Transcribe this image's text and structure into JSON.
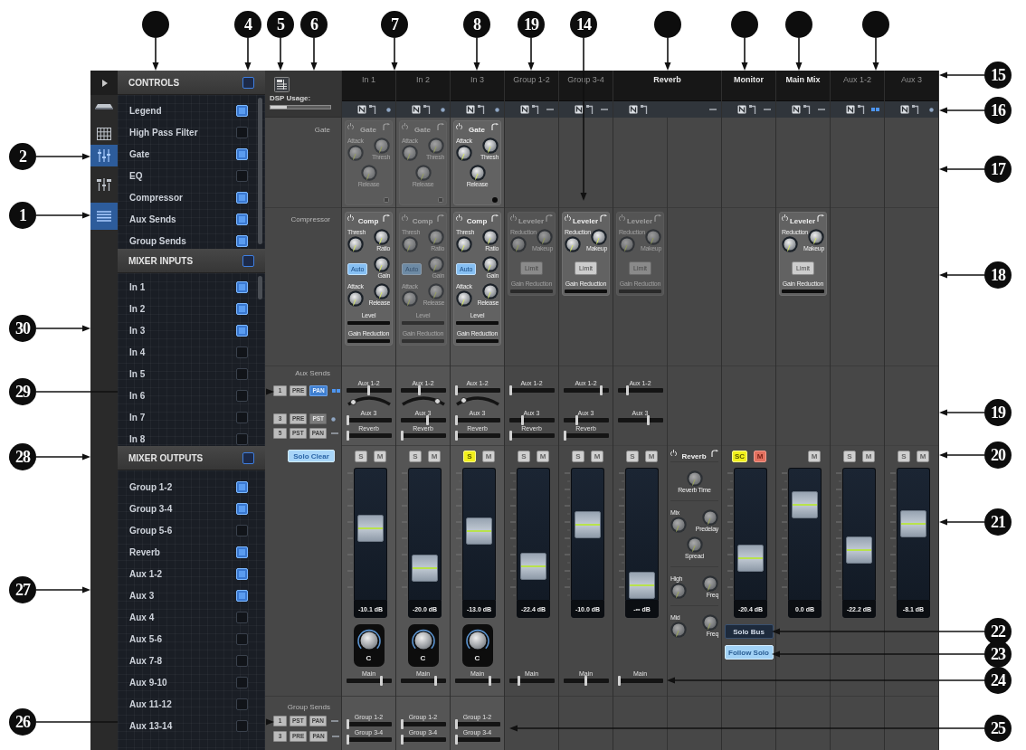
{
  "callouts": {
    "top": [
      {
        "kind": "blank"
      },
      {
        "kind": "numbered",
        "label": "4"
      },
      {
        "kind": "numbered",
        "label": "5"
      },
      {
        "kind": "numbered",
        "label": "6"
      },
      {
        "kind": "numbered",
        "label": "7"
      },
      {
        "kind": "numbered",
        "label": "8"
      },
      {
        "kind": "numbered",
        "label": "19"
      },
      {
        "kind": "numbered",
        "label": "14"
      },
      {
        "kind": "blank"
      },
      {
        "kind": "blank"
      },
      {
        "kind": "blank"
      },
      {
        "kind": "blank"
      }
    ],
    "left": [
      {
        "kind": "numbered",
        "label": "2"
      },
      {
        "kind": "numbered",
        "label": "1"
      },
      {
        "kind": "numbered",
        "label": "30"
      },
      {
        "kind": "numbered",
        "label": "29"
      },
      {
        "kind": "numbered",
        "label": "28"
      },
      {
        "kind": "numbered",
        "label": "27"
      },
      {
        "kind": "numbered",
        "label": "26"
      }
    ],
    "right": [
      {
        "kind": "numbered",
        "label": "15"
      },
      {
        "kind": "numbered",
        "label": "16"
      },
      {
        "kind": "numbered",
        "label": "17"
      },
      {
        "kind": "numbered",
        "label": "18"
      },
      {
        "kind": "numbered",
        "label": "19"
      },
      {
        "kind": "numbered",
        "label": "20"
      },
      {
        "kind": "numbered",
        "label": "21"
      },
      {
        "kind": "numbered",
        "label": "22"
      },
      {
        "kind": "numbered",
        "label": "23"
      },
      {
        "kind": "numbered",
        "label": "24"
      },
      {
        "kind": "numbered",
        "label": "25"
      }
    ]
  },
  "rail": {
    "items": [
      {
        "kind": "device",
        "selected": false
      },
      {
        "kind": "grid",
        "selected": false
      },
      {
        "kind": "sliders",
        "selected": true
      },
      {
        "kind": "mixer",
        "selected": false
      },
      {
        "kind": "list",
        "selected": true
      }
    ]
  },
  "sidebar": {
    "sections": [
      {
        "title": "CONTROLS",
        "indeterminate": true,
        "items": [
          {
            "label": "Legend",
            "checked": true
          },
          {
            "label": "High Pass Filter",
            "checked": false
          },
          {
            "label": "Gate",
            "checked": true
          },
          {
            "label": "EQ",
            "checked": false
          },
          {
            "label": "Compressor",
            "checked": true
          },
          {
            "label": "Aux Sends",
            "checked": true
          },
          {
            "label": "Group Sends",
            "checked": true
          }
        ]
      },
      {
        "title": "MIXER INPUTS",
        "indeterminate": true,
        "items": [
          {
            "label": "In 1",
            "checked": true
          },
          {
            "label": "In 2",
            "checked": true
          },
          {
            "label": "In 3",
            "checked": true
          },
          {
            "label": "In 4",
            "checked": false
          },
          {
            "label": "In 5",
            "checked": false
          },
          {
            "label": "In 6",
            "checked": false
          },
          {
            "label": "In 7",
            "checked": false
          },
          {
            "label": "In 8",
            "checked": false
          }
        ]
      },
      {
        "title": "MIXER OUTPUTS",
        "indeterminate": true,
        "items": [
          {
            "label": "Group 1-2",
            "checked": true
          },
          {
            "label": "Group 3-4",
            "checked": true
          },
          {
            "label": "Group 5-6",
            "checked": false
          },
          {
            "label": "Reverb",
            "checked": true
          },
          {
            "label": "Aux 1-2",
            "checked": true
          },
          {
            "label": "Aux 3",
            "checked": true
          },
          {
            "label": "Aux 4",
            "checked": false
          },
          {
            "label": "Aux 5-6",
            "checked": false
          },
          {
            "label": "Aux 7-8",
            "checked": false
          },
          {
            "label": "Aux 9-10",
            "checked": false
          },
          {
            "label": "Aux 11-12",
            "checked": false
          },
          {
            "label": "Aux 13-14",
            "checked": false
          }
        ]
      }
    ]
  },
  "legend": {
    "dsp_usage": {
      "label": "DSP Usage:",
      "level": 0.27
    },
    "gate": {
      "label": "Gate"
    },
    "dynamics": {
      "label": "Compressor"
    },
    "aux_sends": {
      "label": "Aux Sends",
      "rows": [
        {
          "indicator": {
            "kind": "pair"
          },
          "buttons": [
            {
              "label": "1",
              "on": false,
              "disabled": false
            },
            {
              "label": "PRE",
              "on": false,
              "disabled": false
            },
            {
              "label": "PAN",
              "on": true,
              "disabled": false
            }
          ]
        },
        {
          "indicator": {
            "kind": "dot"
          },
          "buttons": [
            {
              "label": "3",
              "on": false,
              "disabled": false
            },
            {
              "label": "PRE",
              "on": false,
              "disabled": false
            },
            {
              "label": "PST",
              "on": false,
              "disabled": true
            }
          ]
        },
        {
          "indicator": {
            "kind": "dash"
          },
          "buttons": [
            {
              "label": "5",
              "on": false,
              "disabled": false
            },
            {
              "label": "PST",
              "on": false,
              "disabled": false
            },
            {
              "label": "PAN",
              "on": false,
              "disabled": false
            }
          ]
        }
      ]
    },
    "solo_clear": {
      "label": "Solo Clear",
      "on": true
    },
    "group_sends": {
      "label": "Group Sends",
      "rows": [
        {
          "indicator": {
            "kind": "dash"
          },
          "buttons": [
            {
              "label": "1",
              "on": false,
              "disabled": false
            },
            {
              "label": "PST",
              "on": false,
              "disabled": false
            },
            {
              "label": "PAN",
              "on": false,
              "disabled": false
            }
          ]
        },
        {
          "indicator": {
            "kind": "dash"
          },
          "buttons": [
            {
              "label": "3",
              "on": false,
              "disabled": false
            },
            {
              "label": "PRE",
              "on": false,
              "disabled": false
            },
            {
              "label": "PAN",
              "on": false,
              "disabled": false
            }
          ]
        }
      ]
    }
  },
  "strips": [
    {
      "name": "In 1",
      "kind": "input",
      "indicator": {
        "kind": "dot"
      },
      "gate": {
        "title": "Gate",
        "enabled": false,
        "controls": [
          {
            "kind": "knob",
            "label": "Attack"
          },
          {
            "kind": "knob",
            "label": "Thresh"
          },
          {
            "kind": "knob",
            "label": "Release"
          }
        ]
      },
      "dynamics": {
        "title": "Comp",
        "enabled": true,
        "controls": [
          {
            "kind": "knob",
            "label": "Thresh"
          },
          {
            "kind": "knob",
            "label": "Ratio"
          },
          {
            "kind": "button",
            "label": "Auto",
            "on": true
          },
          {
            "kind": "knob",
            "label": "Gain"
          },
          {
            "kind": "knob",
            "label": "Attack"
          },
          {
            "kind": "knob",
            "label": "Release"
          }
        ],
        "meters": [
          {
            "label": "Level"
          },
          {
            "label": "Gain Reduction"
          }
        ]
      },
      "sends": [
        {
          "label": "Aux 1-2",
          "level": 0.5,
          "pan": {
            "level": 0.12
          }
        },
        {
          "label": "Aux 3",
          "level": 0
        },
        {
          "label": "Reverb",
          "level": 0
        }
      ],
      "buttons": [
        {
          "kind": "solo",
          "label": "S",
          "on": false
        },
        {
          "kind": "mute",
          "label": "M",
          "on": false
        }
      ],
      "fader": {
        "level": 0.55,
        "reading": "-10.1 dB"
      },
      "pan": {
        "label": "C"
      },
      "main": {
        "label": "Main",
        "level": 0.8
      },
      "group_sends": [
        {
          "label": "Group 1-2",
          "level": 0
        },
        {
          "label": "Group 3-4",
          "level": 0
        }
      ]
    },
    {
      "name": "In 2",
      "kind": "input",
      "indicator": {
        "kind": "dot"
      },
      "gate": {
        "title": "Gate",
        "enabled": false,
        "controls": [
          {
            "kind": "knob",
            "label": "Attack"
          },
          {
            "kind": "knob",
            "label": "Thresh"
          },
          {
            "kind": "knob",
            "label": "Release"
          }
        ]
      },
      "dynamics": {
        "title": "Comp",
        "enabled": false,
        "controls": [
          {
            "kind": "knob",
            "label": "Thresh"
          },
          {
            "kind": "knob",
            "label": "Ratio"
          },
          {
            "kind": "button",
            "label": "Auto",
            "on": true
          },
          {
            "kind": "knob",
            "label": "Gain"
          },
          {
            "kind": "knob",
            "label": "Attack"
          },
          {
            "kind": "knob",
            "label": "Release"
          }
        ],
        "meters": [
          {
            "label": "Level"
          },
          {
            "label": "Gain Reduction"
          }
        ]
      },
      "sends": [
        {
          "label": "Aux 1-2",
          "level": 0.42,
          "pan": {
            "level": 0.85
          }
        },
        {
          "label": "Aux 3",
          "level": 0.6
        },
        {
          "label": "Reverb",
          "level": 0
        }
      ],
      "buttons": [
        {
          "kind": "solo",
          "label": "S",
          "on": false
        },
        {
          "kind": "mute",
          "label": "M",
          "on": false
        }
      ],
      "fader": {
        "level": 0.17,
        "reading": "-20.0 dB"
      },
      "pan": {
        "label": "C"
      },
      "main": {
        "label": "Main",
        "level": 0.8
      },
      "group_sends": [
        {
          "label": "Group 1-2",
          "level": 0
        },
        {
          "label": "Group 3-4",
          "level": 0
        }
      ]
    },
    {
      "name": "In 3",
      "kind": "input",
      "indicator": {
        "kind": "dot"
      },
      "gate": {
        "title": "Gate",
        "enabled": true,
        "controls": [
          {
            "kind": "knob",
            "label": "Attack"
          },
          {
            "kind": "knob",
            "label": "Thresh"
          },
          {
            "kind": "knob",
            "label": "Release"
          }
        ]
      },
      "dynamics": {
        "title": "Comp",
        "enabled": true,
        "controls": [
          {
            "kind": "knob",
            "label": "Thresh"
          },
          {
            "kind": "knob",
            "label": "Ratio"
          },
          {
            "kind": "button",
            "label": "Auto",
            "on": true
          },
          {
            "kind": "knob",
            "label": "Gain"
          },
          {
            "kind": "knob",
            "label": "Attack"
          },
          {
            "kind": "knob",
            "label": "Release"
          }
        ],
        "meters": [
          {
            "label": "Level"
          },
          {
            "label": "Gain Reduction"
          }
        ]
      },
      "sends": [
        {
          "label": "Aux 1-2",
          "level": 0,
          "pan": {
            "level": 0.18
          }
        },
        {
          "label": "Aux 3",
          "level": 0
        },
        {
          "label": "Reverb",
          "level": 0
        }
      ],
      "buttons": [
        {
          "kind": "solo",
          "label": "S",
          "on": true
        },
        {
          "kind": "mute",
          "label": "M",
          "on": false
        }
      ],
      "fader": {
        "level": 0.53,
        "reading": "-13.0 dB"
      },
      "pan": {
        "label": "C"
      },
      "main": {
        "label": "Main",
        "level": 0.8
      },
      "group_sends": [
        {
          "label": "Group 1-2",
          "level": 0
        },
        {
          "label": "Group 3-4",
          "level": 0
        }
      ]
    },
    {
      "name": "Group 1-2",
      "kind": "group",
      "indicator": {
        "kind": "dash"
      },
      "dynamics": {
        "title": "Leveler",
        "enabled": false,
        "controls": [
          {
            "kind": "knob",
            "label": "Reduction"
          },
          {
            "kind": "knob",
            "label": "Makeup"
          },
          {
            "kind": "button",
            "label": "Limit",
            "on": false
          }
        ],
        "meters": [
          {
            "label": "Gain Reduction"
          }
        ]
      },
      "sends": [
        {
          "label": "Aux 1-2",
          "level": 0
        },
        {
          "label": "Aux 3",
          "level": 0.28
        },
        {
          "label": "Reverb",
          "level": 0
        }
      ],
      "buttons": [
        {
          "kind": "solo",
          "label": "S",
          "on": false
        },
        {
          "kind": "mute",
          "label": "M",
          "on": false
        }
      ],
      "fader": {
        "level": 0.18,
        "reading": "-22.4 dB"
      },
      "main": {
        "label": "Main",
        "level": 0.2
      }
    },
    {
      "name": "Group 3-4",
      "kind": "group",
      "indicator": {
        "kind": "dash"
      },
      "dynamics": {
        "title": "Leveler",
        "enabled": true,
        "controls": [
          {
            "kind": "knob",
            "label": "Reduction"
          },
          {
            "kind": "knob",
            "label": "Makeup"
          },
          {
            "kind": "button",
            "label": "Limit",
            "on": false
          }
        ],
        "meters": [
          {
            "label": "Gain Reduction"
          }
        ]
      },
      "sends": [
        {
          "label": "Aux 1-2",
          "level": 0.86
        },
        {
          "label": "Aux 3",
          "level": 0.28
        },
        {
          "label": "Reverb",
          "level": 0
        }
      ],
      "buttons": [
        {
          "kind": "solo",
          "label": "S",
          "on": false
        },
        {
          "kind": "mute",
          "label": "M",
          "on": false
        }
      ],
      "fader": {
        "level": 0.59,
        "reading": "-10.0 dB"
      },
      "main": {
        "label": "Main",
        "level": 0.5
      }
    },
    {
      "name": "Reverb",
      "kind": "fx",
      "indicator": {
        "kind": "dash"
      },
      "dynamics": {
        "title": "Leveler",
        "enabled": false,
        "controls": [
          {
            "kind": "knob",
            "label": "Reduction"
          },
          {
            "kind": "knob",
            "label": "Makeup"
          },
          {
            "kind": "button",
            "label": "Limit",
            "on": false
          }
        ],
        "meters": [
          {
            "label": "Gain Reduction"
          }
        ]
      },
      "sends": [
        {
          "label": "Aux 1-2",
          "level": 0.2
        },
        {
          "label": "Aux 3",
          "level": 0.7
        }
      ],
      "buttons": [
        {
          "kind": "solo",
          "label": "S",
          "on": false
        },
        {
          "kind": "mute",
          "label": "M",
          "on": false
        }
      ],
      "fader": {
        "level": 0,
        "reading": "-∞ dB"
      },
      "main": {
        "label": "Main",
        "level": 0
      },
      "panel": {
        "title": "Reverb",
        "sections": [
          {
            "controls": [
              {
                "kind": "knob",
                "label": "Reverb Time"
              }
            ]
          },
          {
            "controls": [
              {
                "kind": "knob",
                "label": "Mix"
              },
              {
                "kind": "knob",
                "label": "Predelay"
              },
              {
                "kind": "knob",
                "label": "Spread"
              }
            ]
          },
          {
            "controls": [
              {
                "kind": "knob",
                "label": "High"
              },
              {
                "kind": "knob",
                "label": "Freq"
              }
            ]
          },
          {
            "controls": [
              {
                "kind": "knob",
                "label": "Mid"
              },
              {
                "kind": "knob",
                "label": "Freq"
              }
            ]
          }
        ]
      }
    },
    {
      "name": "Monitor",
      "kind": "monitor",
      "indicator": {
        "kind": "dash"
      },
      "buttons": [
        {
          "kind": "solo",
          "label": "SC",
          "on": true
        },
        {
          "kind": "mute",
          "label": "M",
          "on": true
        }
      ],
      "fader": {
        "level": 0.26,
        "reading": "-20.4 dB"
      },
      "extras": [
        {
          "label": "Solo Bus",
          "on": false
        },
        {
          "label": "Follow Solo",
          "on": true
        }
      ]
    },
    {
      "name": "Main Mix",
      "kind": "main",
      "indicator": {
        "kind": "dash"
      },
      "dynamics": {
        "title": "Leveler",
        "enabled": true,
        "controls": [
          {
            "kind": "knob",
            "label": "Reduction"
          },
          {
            "kind": "knob",
            "label": "Makeup"
          },
          {
            "kind": "button",
            "label": "Limit",
            "on": false
          }
        ],
        "meters": [
          {
            "label": "Gain Reduction"
          }
        ]
      },
      "buttons": [
        {
          "kind": "mute",
          "label": "M",
          "on": false
        }
      ],
      "fader": {
        "level": 0.78,
        "reading": "0.0 dB"
      }
    },
    {
      "name": "Aux 1-2",
      "kind": "aux",
      "indicator": {
        "kind": "pair"
      },
      "buttons": [
        {
          "kind": "solo",
          "label": "S",
          "on": false
        },
        {
          "kind": "mute",
          "label": "M",
          "on": false
        }
      ],
      "fader": {
        "level": 0.34,
        "reading": "-22.2 dB"
      }
    },
    {
      "name": "Aux 3",
      "kind": "aux",
      "indicator": {
        "kind": "dot"
      },
      "buttons": [
        {
          "kind": "solo",
          "label": "S",
          "on": false
        },
        {
          "kind": "mute",
          "label": "M",
          "on": false
        }
      ],
      "fader": {
        "level": 0.6,
        "reading": "-8.1 dB"
      }
    }
  ]
}
